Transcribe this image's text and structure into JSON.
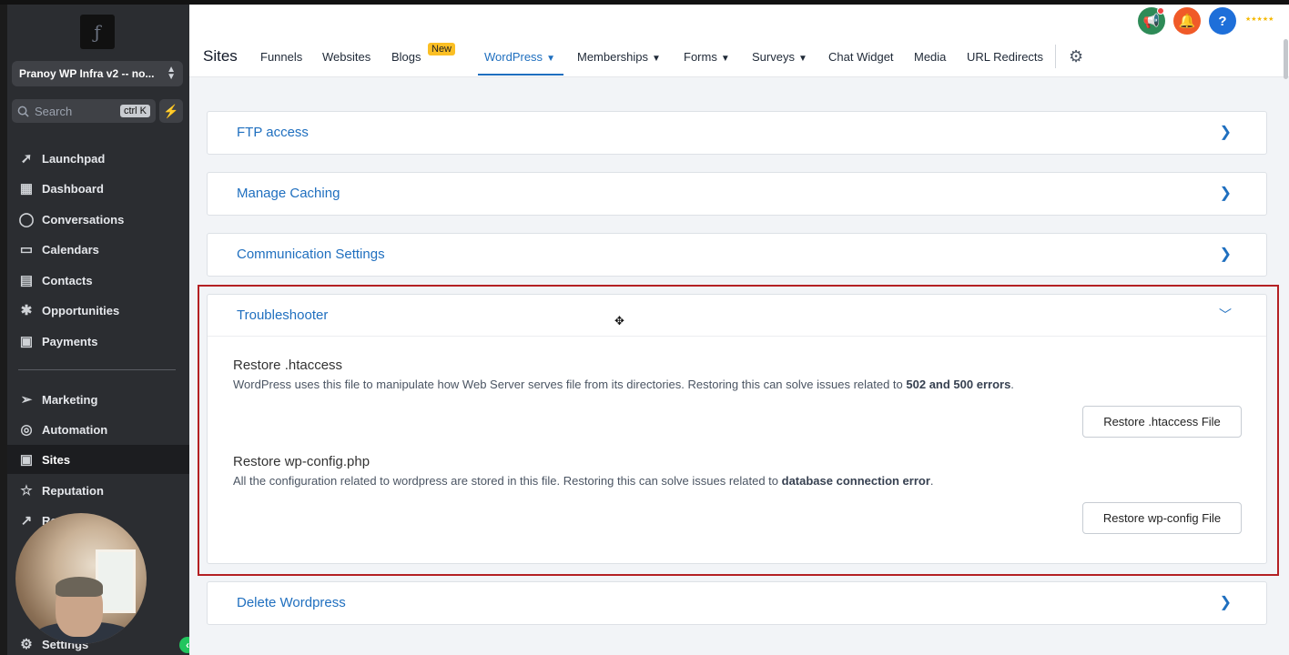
{
  "sidebar": {
    "account_name": "Pranoy WP Infra v2 -- no...",
    "search_placeholder": "Search",
    "search_shortcut": "ctrl K",
    "items": [
      {
        "label": "Launchpad",
        "icon": "rocket-icon"
      },
      {
        "label": "Dashboard",
        "icon": "grid-icon"
      },
      {
        "label": "Conversations",
        "icon": "chat-icon"
      },
      {
        "label": "Calendars",
        "icon": "calendar-icon"
      },
      {
        "label": "Contacts",
        "icon": "contacts-icon"
      },
      {
        "label": "Opportunities",
        "icon": "opportunities-icon"
      },
      {
        "label": "Payments",
        "icon": "payments-icon"
      },
      {
        "label": "Marketing",
        "icon": "send-icon"
      },
      {
        "label": "Automation",
        "icon": "automation-icon"
      },
      {
        "label": "Sites",
        "icon": "sites-icon"
      },
      {
        "label": "Reputation",
        "icon": "star-icon"
      },
      {
        "label": "Re",
        "icon": "trend-icon"
      },
      {
        "label": "Settings",
        "icon": "gear-icon"
      }
    ],
    "active_item": "Sites"
  },
  "header": {
    "page_title": "Sites",
    "tabs": [
      {
        "label": "Funnels"
      },
      {
        "label": "Websites"
      },
      {
        "label": "Blogs"
      },
      {
        "label": "WordPress"
      },
      {
        "label": "Memberships"
      },
      {
        "label": "Forms"
      },
      {
        "label": "Surveys"
      },
      {
        "label": "Chat Widget"
      },
      {
        "label": "Media"
      },
      {
        "label": "URL Redirects"
      }
    ],
    "new_badge": "New",
    "active_tab": "WordPress",
    "help_icon_text": "?",
    "accent_color": "#1f6fbf"
  },
  "panels": {
    "ftp": {
      "title": "FTP access"
    },
    "caching": {
      "title": "Manage Caching"
    },
    "communication": {
      "title": "Communication Settings"
    },
    "troubleshooter": {
      "title": "Troubleshooter",
      "htaccess": {
        "title": "Restore .htaccess",
        "desc": "WordPress uses this file to manipulate how Web Server serves file from its directories. Restoring this can solve issues related to ",
        "desc_bold": "502 and 500 errors",
        "desc_end": ".",
        "button": "Restore .htaccess File"
      },
      "wpconfig": {
        "title": "Restore wp-config.php",
        "desc": "All the configuration related to wordpress are stored in this file. Restoring this can solve issues related to ",
        "desc_bold": "database connection error",
        "desc_end": ".",
        "button": "Restore wp-config File"
      }
    },
    "delete": {
      "title": "Delete Wordpress"
    }
  }
}
